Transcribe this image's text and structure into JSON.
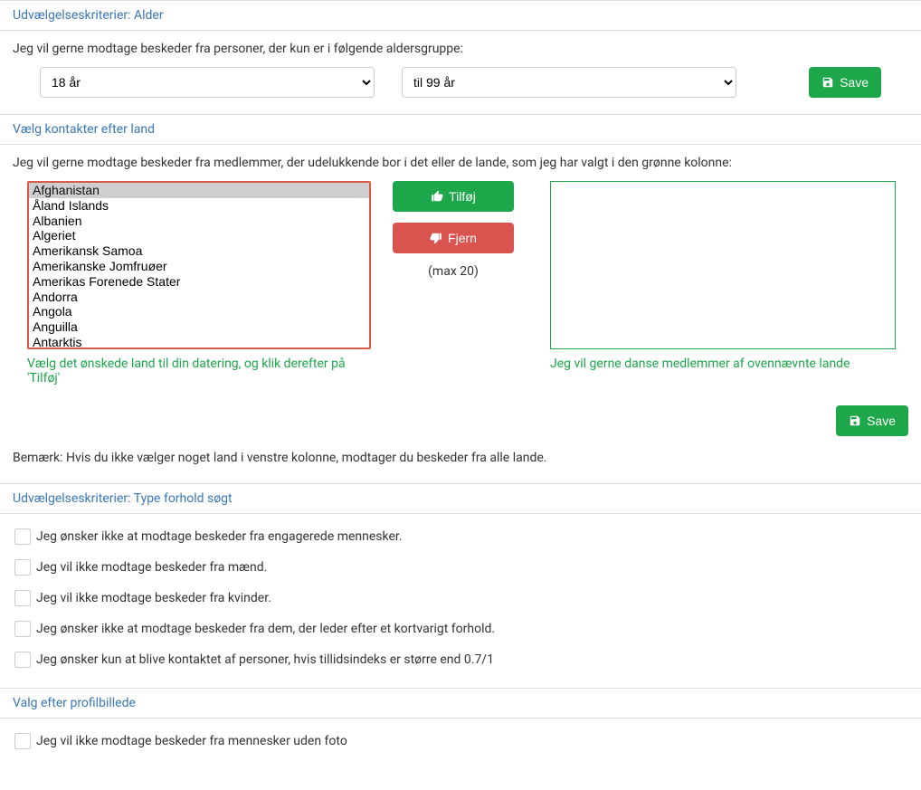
{
  "sections": {
    "age": {
      "title": "Udvælgelseskriterier: Alder",
      "description": "Jeg vil gerne modtage beskeder fra personer, der kun er i følgende aldersgruppe:",
      "from_selected": "18 år",
      "to_selected": "til 99 år",
      "save_label": "Save"
    },
    "country": {
      "title": "Vælg kontakter efter land",
      "description": "Jeg vil gerne modtage beskeder fra medlemmer, der udelukkende bor i det eller de lande, som jeg har valgt i den grønne kolonne:",
      "available_countries": [
        "Afghanistan",
        "Åland Islands",
        "Albanien",
        "Algeriet",
        "Amerikansk Samoa",
        "Amerikanske Jomfruøer",
        "Amerikas Forenede Stater",
        "Andorra",
        "Angola",
        "Anguilla",
        "Antarktis"
      ],
      "add_label": "Tilføj",
      "remove_label": "Fjern",
      "max_note": "(max 20)",
      "left_hint": "Vælg det ønskede land til din datering, og klik derefter på 'Tilføj'",
      "right_hint": "Jeg vil gerne danse medlemmer af ovennævnte lande",
      "save_label": "Save",
      "note": "Bemærk: Hvis du ikke vælger noget land i venstre kolonne, modtager du beskeder fra alle lande."
    },
    "relationship": {
      "title": "Udvælgelseskriterier: Type forhold søgt",
      "options": [
        "Jeg ønsker ikke at modtage beskeder fra engagerede mennesker.",
        "Jeg vil ikke modtage beskeder fra mænd.",
        "Jeg vil ikke modtage beskeder fra kvinder.",
        "Jeg ønsker ikke at modtage beskeder fra dem, der leder efter et kortvarigt forhold.",
        "Jeg ønsker kun at blive kontaktet af personer, hvis tillidsindeks er større end 0.7/1"
      ]
    },
    "photo": {
      "title": "Valg efter profilbillede",
      "option": "Jeg vil ikke modtage beskeder fra mennesker uden foto"
    }
  }
}
